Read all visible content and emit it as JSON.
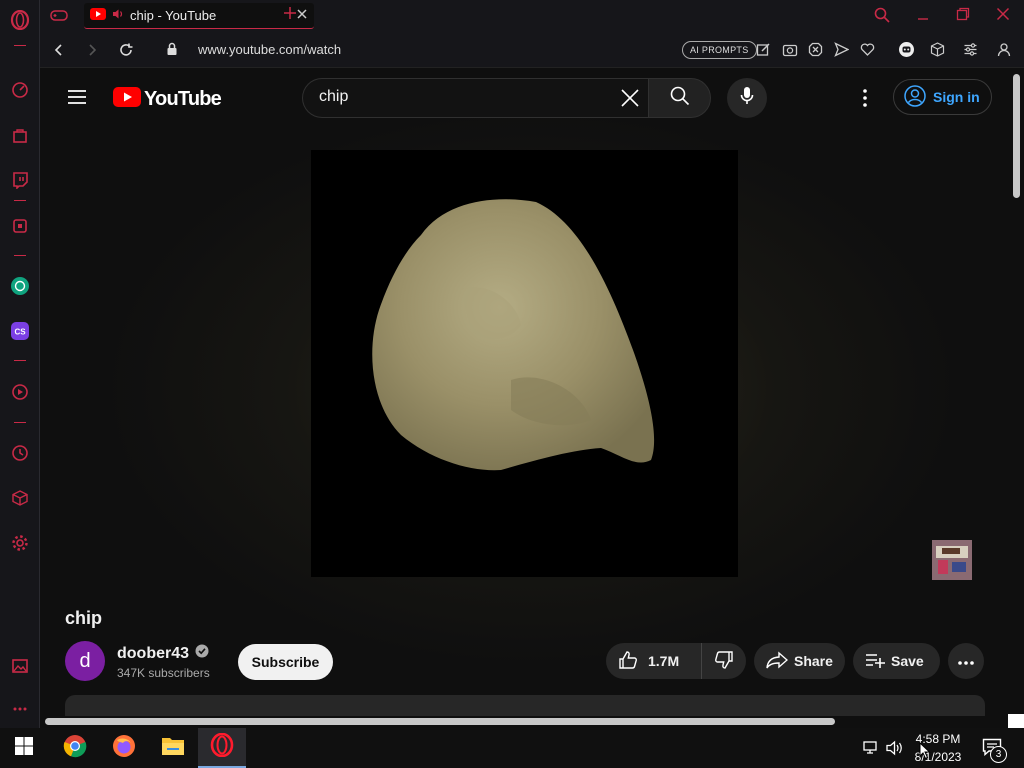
{
  "browser": {
    "tab": {
      "title": "chip - YouTube"
    },
    "url": "www.youtube.com/watch",
    "ai_prompts_label": "AI PROMPTS"
  },
  "youtube": {
    "logo_text": "YouTube",
    "search": {
      "value": "chip"
    },
    "sign_in_label": "Sign in"
  },
  "video": {
    "title": "chip",
    "channel": {
      "avatar_letter": "d",
      "name": "doober43",
      "subscribers": "347K subscribers"
    },
    "subscribe_label": "Subscribe",
    "likes": "1.7M",
    "share_label": "Share",
    "save_label": "Save"
  },
  "taskbar": {
    "time": "4:58 PM",
    "date": "8/1/2023",
    "notification_count": "3"
  },
  "colors": {
    "opera_accent": "#c92a47",
    "youtube_red": "#ff0000",
    "link_blue": "#3ea6ff",
    "avatar_purple": "#7b1fa2"
  }
}
